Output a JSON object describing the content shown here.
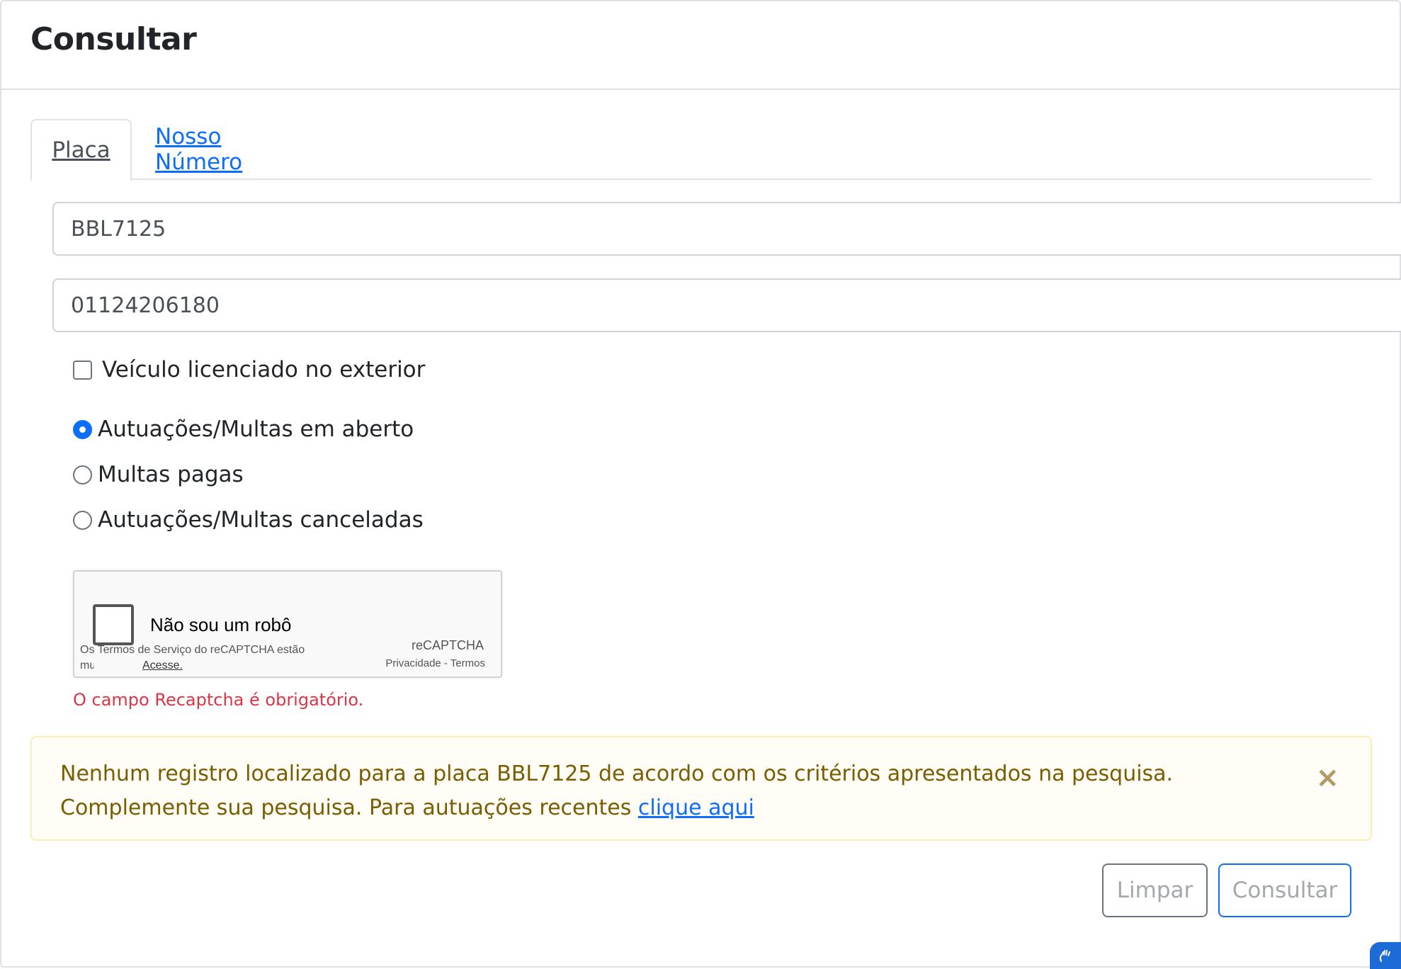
{
  "header": {
    "title": "Consultar"
  },
  "tabs": [
    {
      "label": "Placa",
      "active": true
    },
    {
      "label": "Nosso Número",
      "active": false
    }
  ],
  "form": {
    "plate_value": "BBL7125",
    "document_value": "01124206180",
    "foreign_vehicle_label": "Veículo licenciado no exterior",
    "foreign_vehicle_checked": false,
    "radios": [
      {
        "label": "Autuações/Multas em aberto",
        "checked": true
      },
      {
        "label": "Multas pagas",
        "checked": false
      },
      {
        "label": "Autuações/Multas canceladas",
        "checked": false
      }
    ]
  },
  "recaptcha": {
    "label": "Não sou um robô",
    "brand": "reCAPTCHA",
    "links": "Privacidade - Termos",
    "terms_line1": "Os Termos de Serviço do reCAPTCHA estão",
    "terms_line2_prefix": "mudaram.",
    "terms_link": "Acesse."
  },
  "validation": {
    "recaptcha_error": "O campo Recaptcha é obrigatório."
  },
  "alert": {
    "text": "Nenhum registro localizado para a placa BBL7125 de acordo com os critérios apresentados na pesquisa. Complemente sua pesquisa. Para autuações recentes ",
    "link": "clique aqui",
    "close_symbol": "×"
  },
  "buttons": {
    "clear": "Limpar",
    "submit": "Consultar"
  },
  "colors": {
    "primary": "#0d6efd",
    "danger": "#dc3545",
    "alert_text": "#7a5d00",
    "alert_border": "#ffecb5"
  },
  "icons": {
    "accessibility_widget": "hand-sign-icon"
  }
}
